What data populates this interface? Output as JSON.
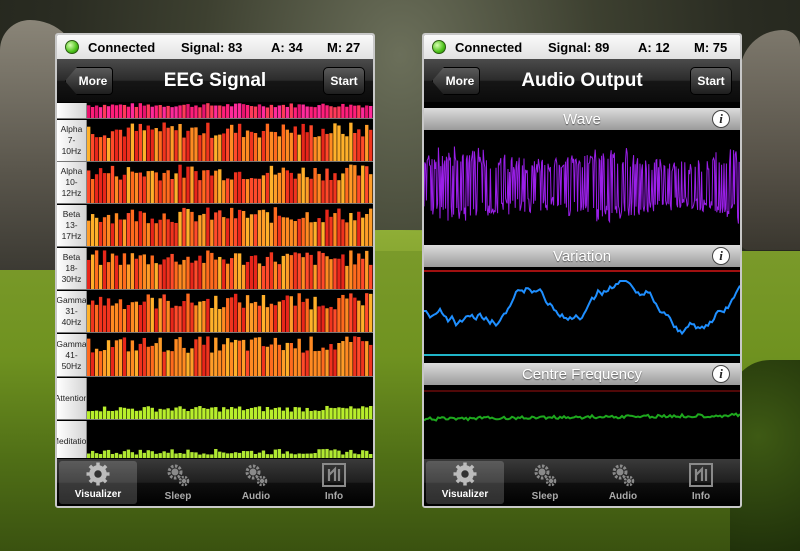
{
  "colors": {
    "wave": "#9a1fe8",
    "variation": "#1f8fff",
    "centre": "#1ea81e",
    "redline": "#a01010",
    "cyanline": "#20b4c8",
    "attention": "#b8ee2c",
    "meditation": "#b0e832"
  },
  "left": {
    "status": {
      "connected": "Connected",
      "signal": "Signal: 83",
      "attention": "A: 34",
      "meditation": "M: 27"
    },
    "nav": {
      "more": "More",
      "title": "EEG Signal",
      "start": "Start"
    },
    "eeg_rows": [
      {
        "label": ""
      },
      {
        "label": "Alpha 7-10Hz"
      },
      {
        "label": "Alpha 10-12Hz"
      },
      {
        "label": "Beta 13-17Hz"
      },
      {
        "label": "Beta 18-30Hz"
      },
      {
        "label": "Gamma 31-40Hz"
      },
      {
        "label": "Gamma 41-50Hz"
      },
      {
        "label": "Attention"
      },
      {
        "label": "Meditation"
      }
    ],
    "tabs": [
      {
        "label": "Visualizer",
        "icon": "gear-icon"
      },
      {
        "label": "Sleep",
        "icon": "gears-icon"
      },
      {
        "label": "Audio",
        "icon": "gears-icon"
      },
      {
        "label": "Info",
        "icon": "brain-logo-icon"
      }
    ]
  },
  "right": {
    "status": {
      "connected": "Connected",
      "signal": "Signal: 89",
      "attention": "A: 12",
      "meditation": "M: 75"
    },
    "nav": {
      "more": "More",
      "title": "Audio Output",
      "start": "Start"
    },
    "panels": [
      {
        "title": "Wave"
      },
      {
        "title": "Variation"
      },
      {
        "title": "Centre Frequency"
      }
    ],
    "tabs": [
      {
        "label": "Visualizer",
        "icon": "gear-icon"
      },
      {
        "label": "Sleep",
        "icon": "gears-icon"
      },
      {
        "label": "Audio",
        "icon": "gears-icon"
      },
      {
        "label": "Info",
        "icon": "brain-logo-icon"
      }
    ]
  }
}
